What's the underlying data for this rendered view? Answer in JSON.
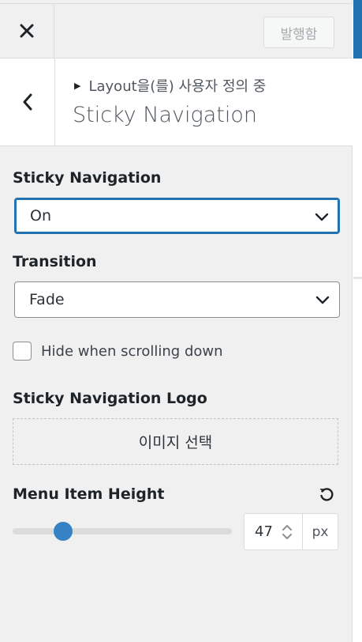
{
  "header": {
    "close_icon": "close-icon",
    "publish_label": "발행함"
  },
  "section": {
    "back_icon": "chevron-left-icon",
    "breadcrumb": "Layout을(를) 사용자 정의 중",
    "title": "Sticky Navigation"
  },
  "controls": {
    "sticky_nav": {
      "label": "Sticky Navigation",
      "value": "On"
    },
    "transition": {
      "label": "Transition",
      "value": "Fade"
    },
    "hide_scroll": {
      "label": "Hide when scrolling down",
      "checked": false
    },
    "logo": {
      "label": "Sticky Navigation Logo",
      "button": "이미지 선택"
    },
    "menu_height": {
      "label": "Menu Item Height",
      "value": "47",
      "unit": "px",
      "slider_fraction": 0.23
    }
  },
  "colors": {
    "accent": "#2271b1",
    "slider_thumb": "#3582c4",
    "panel_bg": "#f0f0f1"
  }
}
